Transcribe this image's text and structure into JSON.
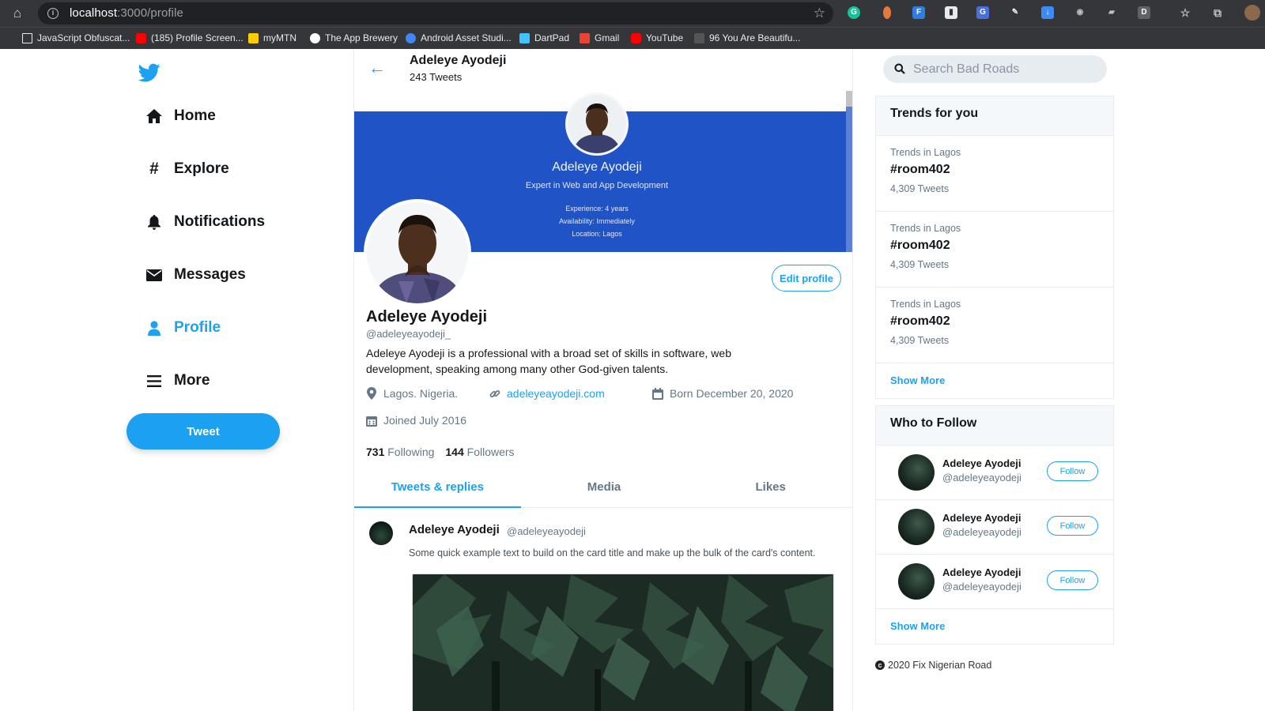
{
  "browser": {
    "url_host": "localhost",
    "url_path": ":3000/profile",
    "bookmarks": [
      {
        "label": "JavaScript Obfuscat...",
        "color": "#e8eaed"
      },
      {
        "label": "(185) Profile Screen...",
        "color": "#ff0000"
      },
      {
        "label": "myMTN",
        "color": "#ffcc00"
      },
      {
        "label": "The App Brewery",
        "color": "#ffffff"
      },
      {
        "label": "Android Asset Studi...",
        "color": "#4285f4"
      },
      {
        "label": "DartPad",
        "color": "#40c4ff"
      },
      {
        "label": "Gmail",
        "color": "#ea4335"
      },
      {
        "label": "YouTube",
        "color": "#ff0000"
      },
      {
        "label": "96 You Are Beautifu...",
        "color": "#888888"
      }
    ]
  },
  "nav": {
    "items": [
      {
        "label": "Home",
        "icon": "home-icon"
      },
      {
        "label": "Explore",
        "icon": "hashtag-icon"
      },
      {
        "label": "Notifications",
        "icon": "bell-icon"
      },
      {
        "label": "Messages",
        "icon": "envelope-icon"
      },
      {
        "label": "Profile",
        "icon": "user-icon",
        "active": true
      },
      {
        "label": "More",
        "icon": "menu-icon"
      }
    ],
    "tweet_button": "Tweet",
    "accent": "#1da1f2"
  },
  "header": {
    "name": "Adeleye Ayodeji",
    "tweet_count": "243 Tweets"
  },
  "banner": {
    "name": "Adeleye Ayodeji",
    "subtitle": "Expert in Web and App Development",
    "experience": "Experience: 4 years",
    "availability": "Availability: Immediately",
    "location": "Location: Lagos",
    "color": "#1f53c6"
  },
  "profile": {
    "name": "Adeleye Ayodeji",
    "handle": "@adeleyeayodeji_",
    "bio": "Adeleye Ayodeji is a professional with a broad set of skills in software, web development, speaking among many other God-given talents.",
    "location": "Lagos. Nigeria.",
    "website": "adeleyeayodeji.com",
    "birthday": "Born December 20, 2020",
    "joined": "Joined July 2016",
    "following_count": "731",
    "following_label": "Following",
    "followers_count": "144",
    "followers_label": "Followers",
    "edit_button": "Edit profile"
  },
  "tabs": [
    {
      "label": "Tweets & replies",
      "active": true
    },
    {
      "label": "Media"
    },
    {
      "label": "Likes"
    }
  ],
  "tweet": {
    "name": "Adeleye Ayodeji",
    "handle": "@adeleyeayodeji",
    "text": "Some quick example text to build on the card title and make up the bulk of the card's content."
  },
  "search": {
    "placeholder": "Search Bad Roads"
  },
  "trends": {
    "title": "Trends for you",
    "items": [
      {
        "location": "Trends in Lagos",
        "tag": "#room402",
        "count": "4,309 Tweets"
      },
      {
        "location": "Trends in Lagos",
        "tag": "#room402",
        "count": "4,309 Tweets"
      },
      {
        "location": "Trends in Lagos",
        "tag": "#room402",
        "count": "4,309 Tweets"
      }
    ],
    "show_more": "Show More"
  },
  "who_to_follow": {
    "title": "Who to Follow",
    "items": [
      {
        "name": "Adeleye Ayodeji",
        "handle": "@adeleyeayodeji",
        "button": "Follow"
      },
      {
        "name": "Adeleye Ayodeji",
        "handle": "@adeleyeayodeji",
        "button": "Follow"
      },
      {
        "name": "Adeleye Ayodeji",
        "handle": "@adeleyeayodeji",
        "button": "Follow"
      }
    ],
    "show_more": "Show More"
  },
  "footer": {
    "text": "2020 Fix Nigerian Road"
  }
}
